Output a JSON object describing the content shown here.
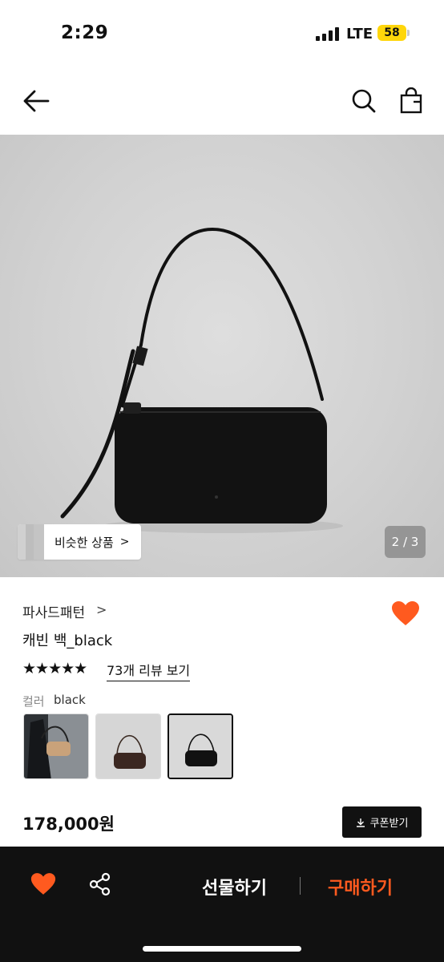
{
  "status_bar": {
    "time": "2:29",
    "network": "LTE",
    "battery": "58"
  },
  "header": {
    "back_icon": "arrow-left-icon",
    "search_icon": "search-icon",
    "bag_icon": "shopping-bag-icon"
  },
  "gallery": {
    "similar_label": "비슷한 상품",
    "similar_chevron": ">",
    "pager": "2 / 3"
  },
  "product": {
    "brand": "파사드패턴",
    "brand_chevron": ">",
    "name": "캐빈 백_black",
    "rating_stars": "★★★★★",
    "review_link": "73개 리뷰 보기",
    "color_label": "컬러",
    "color_value": "black",
    "price": "178,000원",
    "coupon_label": "쿠폰받기",
    "favorited": true
  },
  "bottom_bar": {
    "gift_label": "선물하기",
    "buy_label": "구매하기"
  },
  "colors": {
    "accent_orange": "#ff5a1f",
    "bottom_bar_bg": "#111111",
    "battery_yellow": "#ffd60a"
  }
}
